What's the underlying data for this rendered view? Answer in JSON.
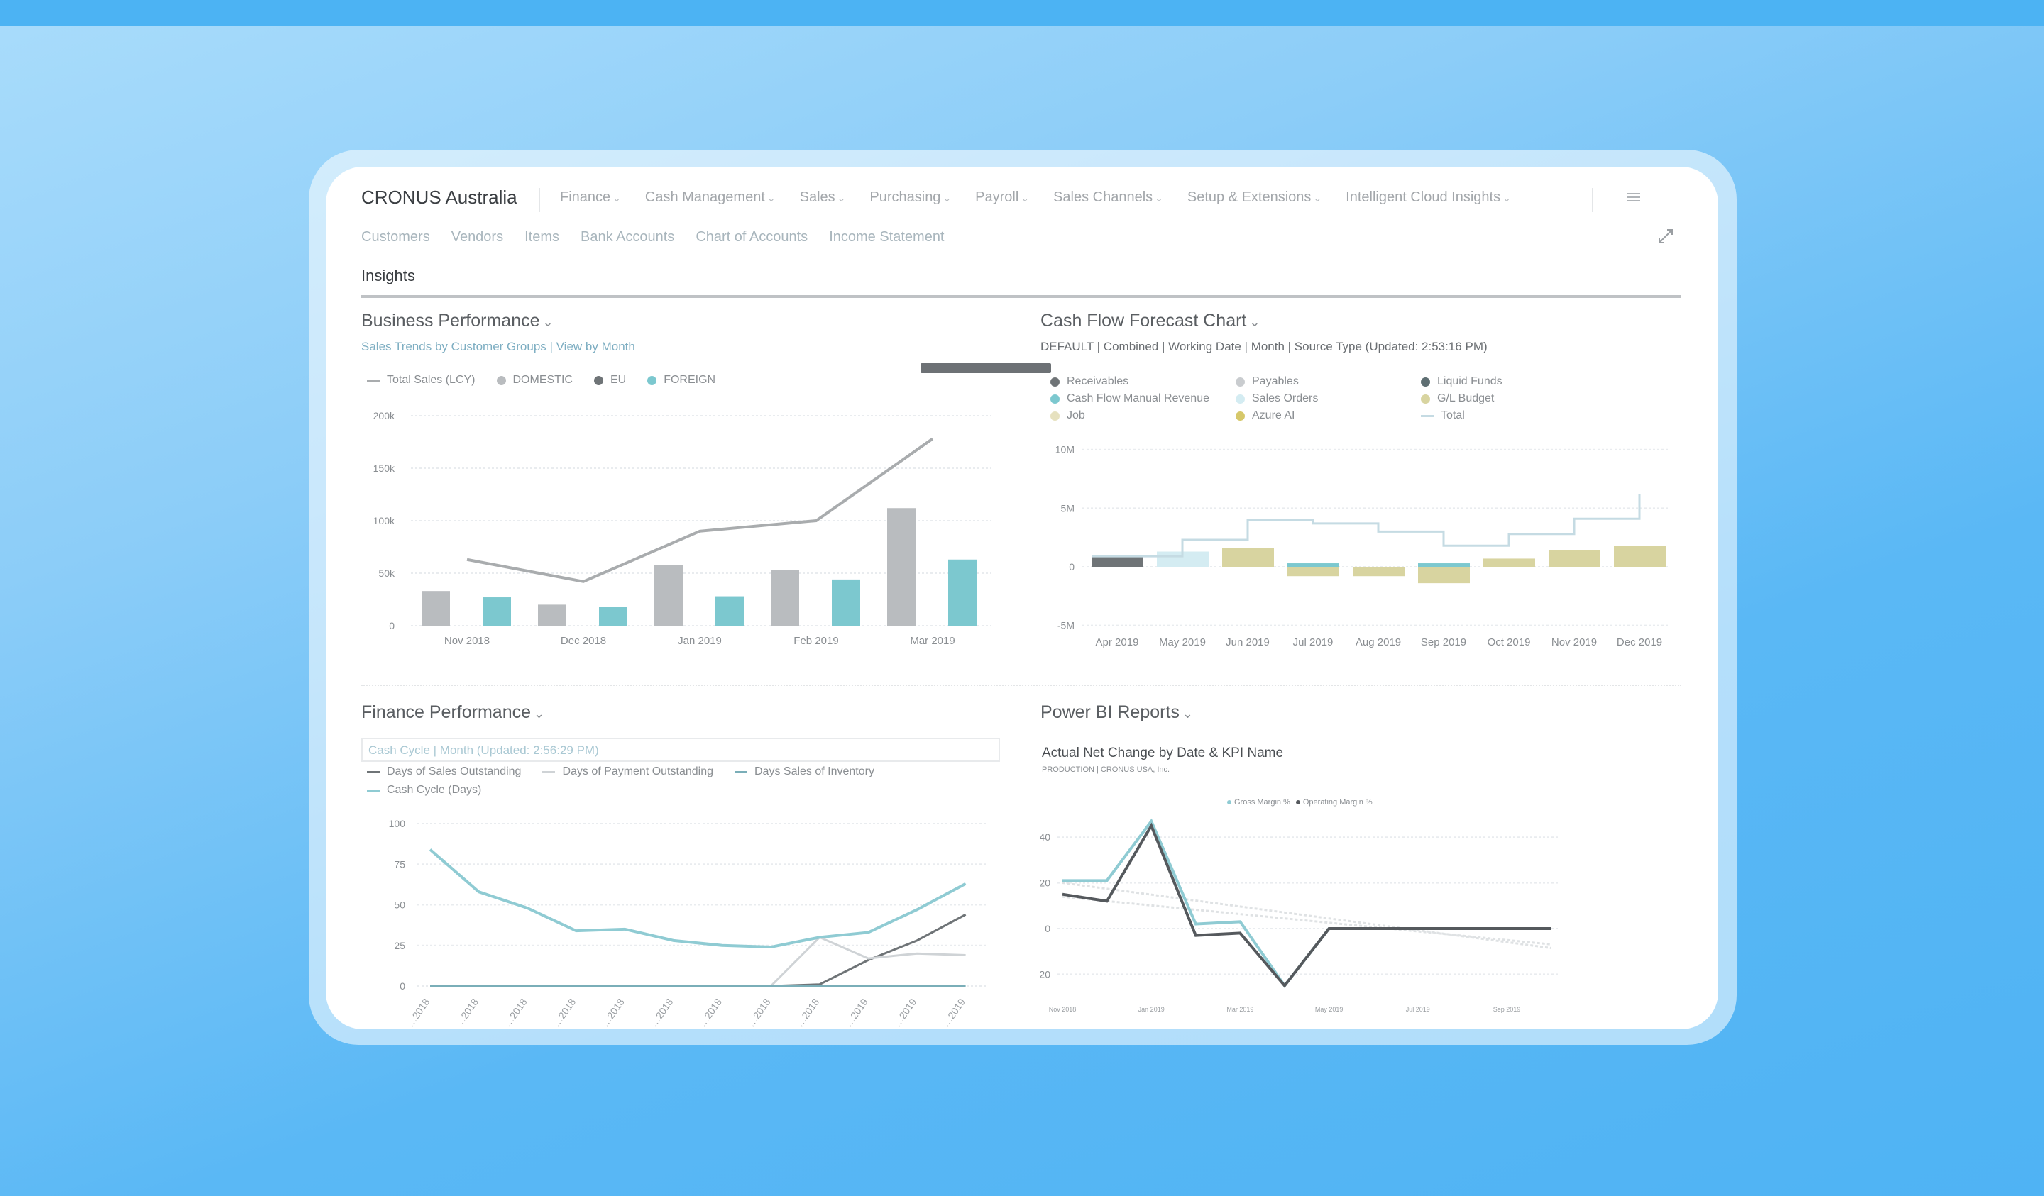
{
  "app": {
    "company": "CRONUS Australia",
    "nav": [
      "Finance",
      "Cash Management",
      "Sales",
      "Purchasing",
      "Payroll",
      "Sales Channels",
      "Setup & Extensions",
      "Intelligent Cloud Insights"
    ],
    "subnav": [
      "Customers",
      "Vendors",
      "Items",
      "Bank Accounts",
      "Chart of Accounts",
      "Income Statement"
    ],
    "section": "Insights",
    "icons": {
      "menu": "list-icon",
      "expand": "expand-icon",
      "chevron": "chevron-down-icon"
    }
  },
  "colors": {
    "domestic": "#b9bcbf",
    "eu": "#6f7477",
    "foreign": "#7cc8cf",
    "total_line": "#a9acae",
    "gl_budget": "#d8d4a0",
    "receivables": "#6f7477",
    "sales_orders": "#d4ecf2",
    "cash_flow_manual": "#7cc8cf",
    "cash_cycle": "#8fcbd3",
    "grid": "#e9ecef"
  },
  "panels": {
    "business": {
      "title": "Business Performance",
      "subtitle": "Sales Trends by Customer Groups | View by Month"
    },
    "cashflow": {
      "title": "Cash Flow Forecast Chart",
      "subtitle": "DEFAULT | Combined | Working Date | Month | Source Type (Updated:  2:53:16 PM)"
    },
    "finance": {
      "title": "Finance Performance",
      "subtitle": "Cash Cycle | Month (Updated:  2:56:29 PM)"
    },
    "powerbi": {
      "title": "Power BI Reports",
      "report_title": "Actual Net Change by Date & KPI Name",
      "report_subtitle": "PRODUCTION | CRONUS USA, Inc."
    }
  },
  "chart_data": [
    {
      "type": "bar",
      "categories": [
        "Nov 2018",
        "Dec 2018",
        "Jan 2019",
        "Feb 2019",
        "Mar 2019"
      ],
      "series": [
        {
          "name": "DOMESTIC",
          "kind": "bar",
          "values": [
            33000,
            20000,
            58000,
            53000,
            112000
          ]
        },
        {
          "name": "EU",
          "kind": "bar",
          "values": [
            0,
            0,
            0,
            0,
            0
          ]
        },
        {
          "name": "FOREIGN",
          "kind": "bar",
          "values": [
            27000,
            18000,
            28000,
            44000,
            63000
          ]
        },
        {
          "name": "Total Sales (LCY)",
          "kind": "line",
          "values": [
            63000,
            42000,
            90000,
            100000,
            178000
          ]
        }
      ],
      "yticks": [
        "0",
        "50k",
        "100k",
        "150k",
        "200k"
      ],
      "ylim": [
        0,
        200000
      ],
      "grid": true,
      "legend": "top-left"
    },
    {
      "type": "bar",
      "stacked": true,
      "categories": [
        "Apr 2019",
        "May 2019",
        "Jun 2019",
        "Jul 2019",
        "Aug 2019",
        "Sep 2019",
        "Oct 2019",
        "Nov 2019",
        "Dec 2019"
      ],
      "series": [
        {
          "name": "Receivables",
          "kind": "bar",
          "values": [
            0.9,
            0,
            0,
            0,
            0,
            0,
            0,
            0,
            0
          ]
        },
        {
          "name": "Payables",
          "kind": "bar",
          "values": [
            0,
            0,
            0,
            0,
            0,
            0,
            0,
            0,
            0
          ]
        },
        {
          "name": "Liquid Funds",
          "kind": "bar",
          "values": [
            0,
            0,
            0,
            0,
            0,
            0,
            0,
            0,
            0
          ]
        },
        {
          "name": "Cash Flow Manual Revenue",
          "kind": "bar",
          "values": [
            0.1,
            0,
            0,
            0.3,
            0,
            0.3,
            0,
            0,
            0
          ]
        },
        {
          "name": "Sales Orders",
          "kind": "bar",
          "values": [
            0,
            1.3,
            0,
            0,
            0,
            0,
            0,
            0,
            0
          ]
        },
        {
          "name": "G/L Budget",
          "kind": "bar",
          "values": [
            0,
            0,
            1.6,
            -0.8,
            -0.8,
            -1.4,
            0.7,
            1.4,
            1.8
          ]
        },
        {
          "name": "Job",
          "kind": "bar",
          "values": [
            0,
            0,
            0,
            0,
            0,
            0,
            0,
            0,
            0
          ]
        },
        {
          "name": "Azure AI",
          "kind": "bar",
          "values": [
            0,
            0,
            0,
            0,
            0,
            0,
            0,
            0,
            0
          ]
        },
        {
          "name": "Total",
          "kind": "step",
          "values": [
            0.9,
            2.3,
            4.0,
            3.7,
            3.0,
            1.8,
            2.8,
            4.1,
            6.2
          ]
        }
      ],
      "unit": "M",
      "yticks": [
        "-5M",
        "0",
        "5M",
        "10M"
      ],
      "ylim": [
        -5,
        10
      ],
      "grid": true,
      "legend": "top"
    },
    {
      "type": "line",
      "categories": [
        "…2018",
        "…2018",
        "…2018",
        "…2018",
        "…2018",
        "…2018",
        "…2018",
        "…2018",
        "…2018",
        "…2019",
        "…2019",
        "…2019"
      ],
      "series": [
        {
          "name": "Days of Sales Outstanding",
          "values": [
            0,
            0,
            0,
            0,
            0,
            0,
            0,
            0,
            1,
            16,
            28,
            44
          ]
        },
        {
          "name": "Days of Payment Outstanding",
          "values": [
            0,
            0,
            0,
            0,
            0,
            0,
            0,
            0,
            30,
            17,
            20,
            19
          ]
        },
        {
          "name": "Days Sales of Inventory",
          "values": [
            0,
            0,
            0,
            0,
            0,
            0,
            0,
            0,
            0,
            0,
            0,
            0
          ]
        },
        {
          "name": "Cash Cycle (Days)",
          "values": [
            84,
            58,
            48,
            34,
            35,
            28,
            25,
            24,
            30,
            33,
            47,
            63
          ]
        }
      ],
      "yticks": [
        "0",
        "25",
        "50",
        "75",
        "100"
      ],
      "ylim": [
        0,
        100
      ],
      "grid": true,
      "legend": "top-left"
    },
    {
      "type": "line",
      "x": [
        "Nov 2018",
        "Dec 2018",
        "Jan 2019",
        "Feb 2019",
        "Mar 2019",
        "Apr 2019",
        "May 2019",
        "Jun 2019",
        "Jul 2019",
        "Aug 2019",
        "Sep 2019",
        "Oct 2019"
      ],
      "xticks": [
        "Nov 2018",
        "Jan 2019",
        "Mar 2019",
        "May 2019",
        "Jul 2019",
        "Sep 2019"
      ],
      "series": [
        {
          "name": "Gross Margin %",
          "values": [
            21,
            21,
            47,
            2,
            3,
            -25,
            0,
            0,
            0,
            0,
            0,
            0
          ]
        },
        {
          "name": "Operating Margin %",
          "values": [
            15,
            12,
            45,
            -3,
            -2,
            -25,
            0,
            0,
            0,
            0,
            0,
            0
          ]
        }
      ],
      "trendlines": true,
      "yticks": [
        "-20",
        "0",
        "20",
        "40"
      ],
      "ylim": [
        -28,
        50
      ],
      "grid": true,
      "legend": "top-center"
    }
  ]
}
